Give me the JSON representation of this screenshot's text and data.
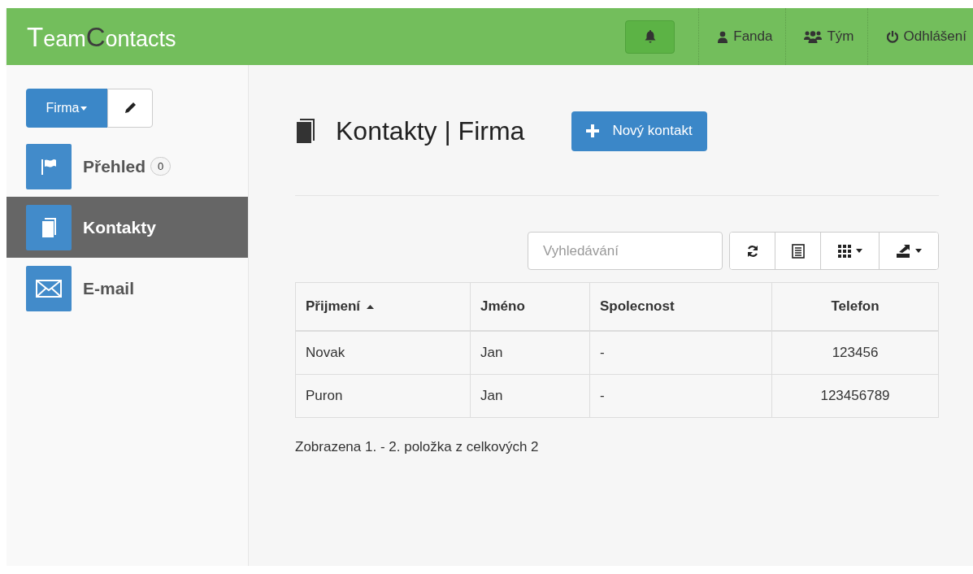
{
  "header": {
    "logo": [
      {
        "text": "T",
        "kind": "initial",
        "dark": false
      },
      {
        "text": "eam",
        "kind": "rest",
        "dark": false
      },
      {
        "text": "C",
        "kind": "initial",
        "dark": true
      },
      {
        "text": "ontacts",
        "kind": "rest",
        "dark": false
      }
    ],
    "nav": [
      {
        "label": "Fanda"
      },
      {
        "label": "Tým"
      },
      {
        "label": "Odhlášení"
      }
    ]
  },
  "sidebar": {
    "switcher": {
      "label": "Firma"
    },
    "items": [
      {
        "label": "Přehled",
        "badge": "0",
        "selected": false
      },
      {
        "label": "Kontakty",
        "selected": true
      },
      {
        "label": "E-mail",
        "selected": false
      }
    ]
  },
  "page": {
    "title": "Kontakty | Firma",
    "new_button": "Nový kontakt",
    "search": {
      "placeholder": "Vyhledávání"
    }
  },
  "table": {
    "columns": [
      {
        "label": "Přijmení",
        "sorted": true,
        "kind": "text"
      },
      {
        "label": "Jméno",
        "sorted": false,
        "kind": "text"
      },
      {
        "label": "Spolecnost",
        "sorted": false,
        "kind": "text"
      },
      {
        "label": "Telefon",
        "sorted": false,
        "kind": "number"
      }
    ],
    "rows": [
      [
        "Novak",
        "Jan",
        "-",
        "123456"
      ],
      [
        "Puron",
        "Jan",
        "-",
        "123456789"
      ]
    ]
  },
  "pagination_info": "Zobrazena 1. - 2. položka z celkových 2"
}
